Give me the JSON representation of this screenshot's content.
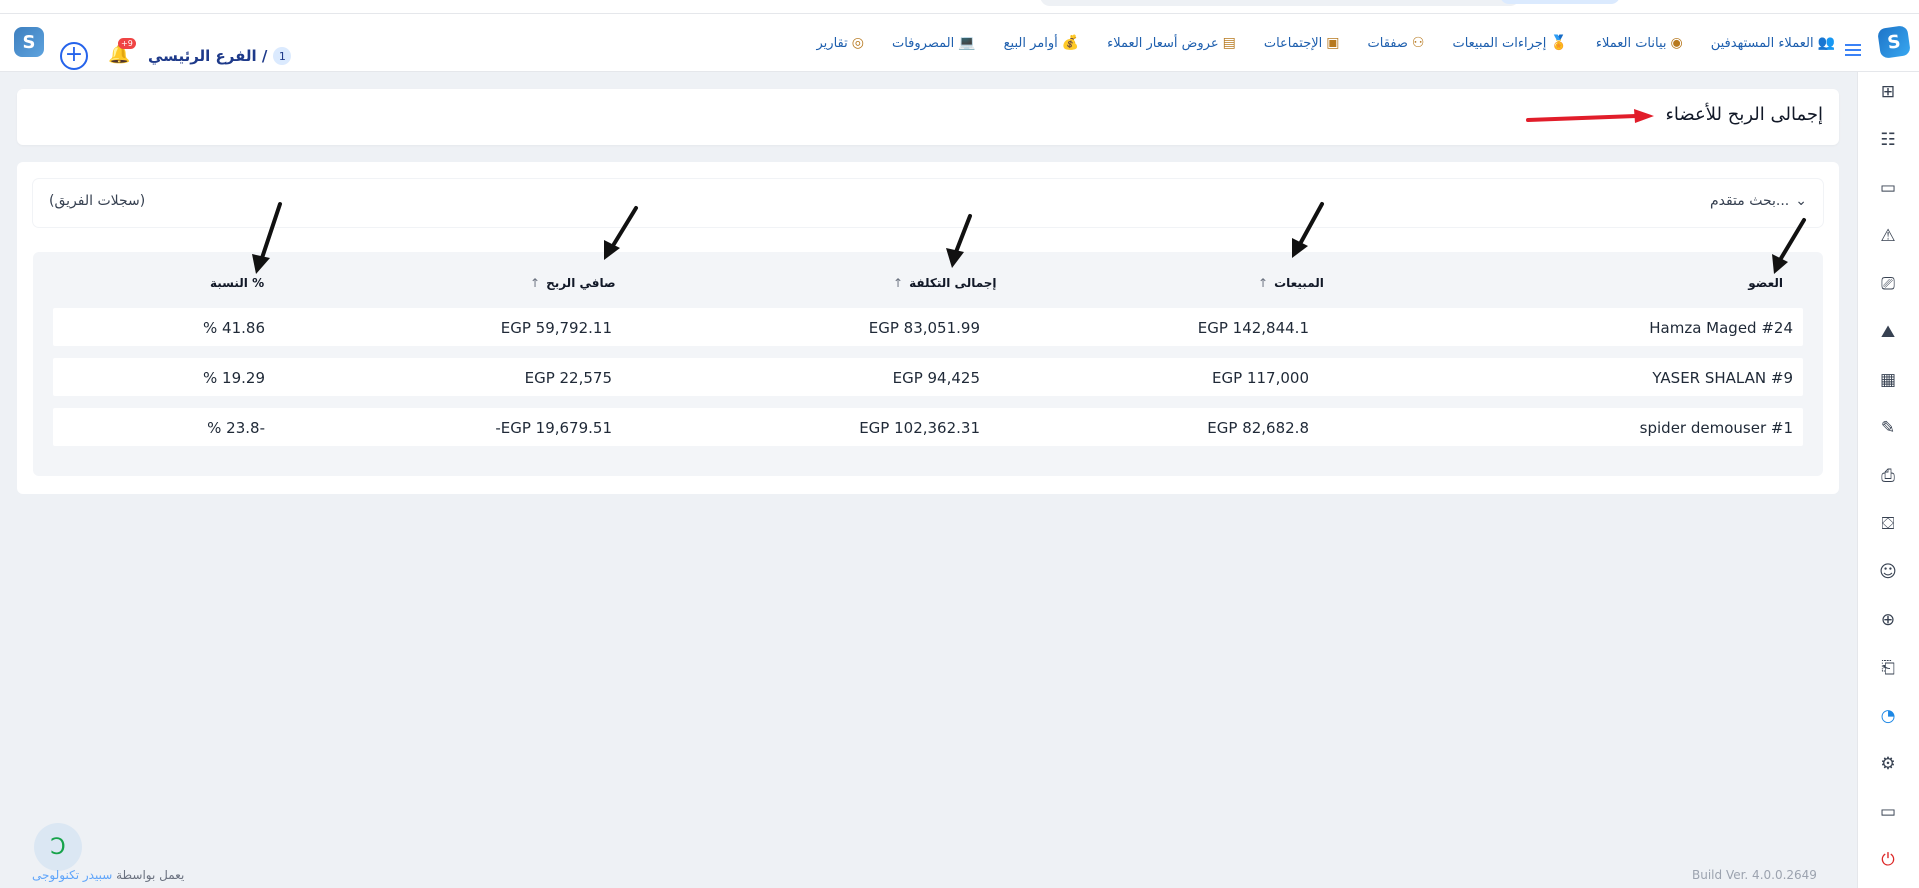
{
  "header": {
    "nav": [
      {
        "label": "العملاء المستهدفين",
        "icon": "target-customers-icon"
      },
      {
        "label": "بيانات العملاء",
        "icon": "customer-data-icon"
      },
      {
        "label": "إجراءات المبيعات",
        "icon": "sales-actions-icon"
      },
      {
        "label": "صفقات",
        "icon": "deals-icon"
      },
      {
        "label": "الإجتماعات",
        "icon": "meetings-icon"
      },
      {
        "label": "عروض أسعار العملاء",
        "icon": "quotes-icon"
      },
      {
        "label": "أوامر البيع",
        "icon": "sales-orders-icon"
      },
      {
        "label": "المصروفات",
        "icon": "expenses-icon"
      },
      {
        "label": "تقارير",
        "icon": "reports-icon"
      }
    ],
    "branch_number": "1",
    "branch_label": "الفرع الرئيسي /",
    "notification_count": "+9"
  },
  "page": {
    "title": "إجمالى الربح للأعضاء",
    "advanced_search": "بحث متقدم...",
    "team_records": "(سجلات الفريق)"
  },
  "table": {
    "headers": {
      "member": "العضو",
      "sales": "المبيعات",
      "total_cost": "إجمالى التكلفة",
      "net_profit": "صافي الربح",
      "ratio": "النسبة %"
    },
    "rows": [
      {
        "member": "Hamza Maged #24",
        "sales": "EGP 142,844.1",
        "total_cost": "EGP 83,051.99",
        "net_profit": "EGP 59,792.11",
        "ratio": "% 41.86"
      },
      {
        "member": "YASER SHALAN #9",
        "sales": "EGP 117,000",
        "total_cost": "EGP 94,425",
        "net_profit": "EGP 22,575",
        "ratio": "% 19.29"
      },
      {
        "member": "spider demouser #1",
        "sales": "EGP 82,682.8",
        "total_cost": "EGP 102,362.31",
        "net_profit": "-EGP 19,679.51",
        "ratio": "% 23.8-"
      }
    ]
  },
  "footer": {
    "build": "Build Ver. 4.0.0.2649",
    "powered_prefix": "يعمل بواسطة",
    "powered_brand": "سبيدر تكنولوجى"
  },
  "colors": {
    "accent": "#1e88e5",
    "nav_text": "#1e5fae",
    "arrow_red": "#e11d2a"
  }
}
